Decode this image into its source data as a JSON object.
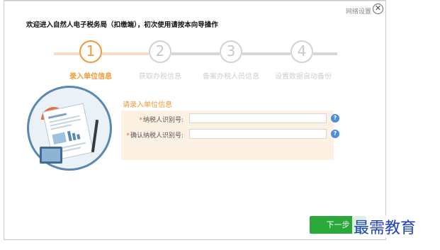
{
  "header": {
    "net_settings": "网络设置",
    "welcome": "欢迎进入自然人电子税务局（扣缴端），初次使用请按本向导操作"
  },
  "steps": [
    {
      "number": "1",
      "label": "录入单位信息",
      "state": "active"
    },
    {
      "number": "2",
      "label": "获取办税信息",
      "state": "idle"
    },
    {
      "number": "3",
      "label": "备案办税人员信息",
      "state": "idle"
    },
    {
      "number": "4",
      "label": "设置数据自动备份",
      "state": "idle"
    }
  ],
  "form": {
    "title": "请录入单位信息",
    "fields": [
      {
        "label": "纳税人识别号:",
        "value": "",
        "required_mark": "*"
      },
      {
        "label": "确认纳税人识别号:",
        "value": "",
        "required_mark": "*"
      }
    ],
    "help_glyph": "?"
  },
  "footer": {
    "next_label": "下一步"
  },
  "watermark": "最需教育",
  "colors": {
    "accent": "#f19a38",
    "next_button": "#2aa93a",
    "help": "#4a8fe0"
  }
}
